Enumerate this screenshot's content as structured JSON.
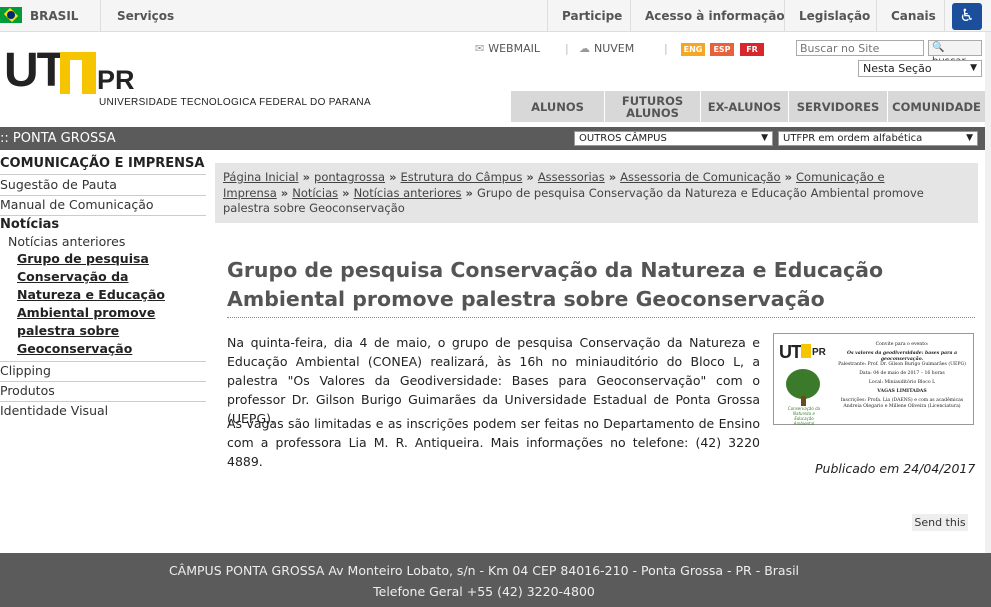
{
  "gov_bar": {
    "country": "BRASIL",
    "services": "Serviços",
    "links": [
      "Participe",
      "Acesso à informação",
      "Legislação",
      "Canais"
    ],
    "accessibility_icon": "accessibility-icon"
  },
  "header": {
    "logo_ut": "UT",
    "logo_pr": "PR",
    "logo_subtitle": "UNIVERSIDADE TECNOLOGICA FEDERAL DO PARANA",
    "webmail": "WEBMAIL",
    "nuvem": "NUVEM",
    "languages": [
      "ENG",
      "ESP",
      "FR"
    ],
    "language_colors": [
      "#f5a623",
      "#e8603c",
      "#d9262c"
    ],
    "search_placeholder": "Buscar no Site",
    "search_button": "buscar",
    "section_select": "Nesta Seção"
  },
  "nav": {
    "items": [
      "ALUNOS",
      "FUTUROS ALUNOS",
      "EX-ALUNOS",
      "SERVIDORES",
      "COMUNIDADE"
    ]
  },
  "campus_bar": {
    "title": ":: PONTA GROSSA",
    "other_campus": "OUTROS CÂMPUS",
    "utfpr_order": "UTFPR em ordem alfabética"
  },
  "sidebar": {
    "heading": "COMUNICAÇÃO E IMPRENSA",
    "items": [
      "Sugestão de Pauta",
      "Manual de Comunicação"
    ],
    "group": "Notícias",
    "sub": "Notícias anteriores",
    "current": "Grupo de pesquisa Conservação da Natureza e Educação Ambiental promove palestra sobre Geoconservação",
    "after": [
      "Clipping",
      "Produtos",
      "Identidade Visual"
    ]
  },
  "breadcrumb": {
    "items": [
      "Página Inicial",
      "pontagrossa",
      "Estrutura do Câmpus",
      "Assessorias",
      "Assessoria de Comunicação",
      "Comunicação e Imprensa",
      "Notícias",
      "Notícias anteriores"
    ],
    "current": "Grupo de pesquisa Conservação da Natureza e Educação Ambiental promove palestra sobre Geoconservação"
  },
  "article": {
    "title": "Grupo de pesquisa Conservação da Natureza e Educação Ambiental promove palestra sobre Geoconservação",
    "p1": "Na quinta-feira, dia 4 de maio, o grupo de pesquisa Conservação da Natureza e Educação Ambiental (CONEA) realizará, às 16h no miniauditório do Bloco L, a palestra \"Os Valores da Geodiversidade: Bases para Geoconservação\" com o professor Dr. Gilson Burigo Guimarães da Universidade Estadual de Ponta Grossa (UEPG).",
    "p2": "As vagas são limitadas e as inscrições podem ser feitas no Departamento de Ensino com a professora Lia M. R. Antiqueira. Mais informações no telefone: (42) 3220 4889.",
    "published": "Publicado em 24/04/2017",
    "send": "Send this"
  },
  "flyer": {
    "logo_ut": "UT",
    "logo_pr": "PR",
    "caption": "Conservação da Natureza e Educação Ambiental",
    "lines": [
      "Convite para o evento:",
      "Os valores da geodiversidade: bases para a geoconservação.",
      "Palestrante: Prof. Dr. Gilson Burigo Guimarães (UEPG)",
      "Data: 04 de maio de 2017 – 16 horas",
      "Local: Miniauditório Bloco L",
      "VAGAS LIMITADAS",
      "Inscrições: Profa. Lia (DAENS) e com as acadêmicas Andreia Olegario e Millene Oliveira (Licenciatura)"
    ]
  },
  "footer": {
    "line1": "CÂMPUS PONTA GROSSA Av Monteiro Lobato, s/n - Km 04 CEP 84016-210 - Ponta Grossa - PR - Brasil",
    "line2": "Telefone Geral +55 (42) 3220-4800"
  }
}
